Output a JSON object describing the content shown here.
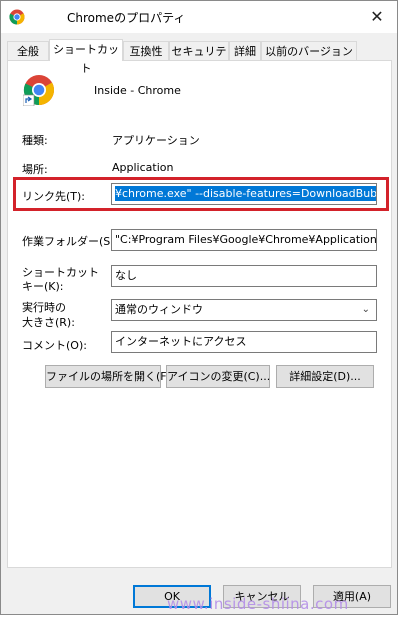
{
  "window": {
    "title": "Chromeのプロパティ",
    "close_glyph": "✕"
  },
  "tabs": [
    {
      "label": "全般",
      "active": false
    },
    {
      "label": "ショートカット",
      "active": true
    },
    {
      "label": "互換性",
      "active": false
    },
    {
      "label": "セキュリティ",
      "active": false
    },
    {
      "label": "詳細",
      "active": false
    },
    {
      "label": "以前のバージョン",
      "active": false
    }
  ],
  "shortcut": {
    "name": "Inside - Chrome",
    "type_label": "種類:",
    "type_value": "アプリケーション",
    "location_label": "場所:",
    "location_value": "Application",
    "target_label": "リンク先(T):",
    "target_value": "¥chrome.exe\" --disable-features=DownloadBubble",
    "startin_label": "作業フォルダー(S):",
    "startin_value": "\"C:¥Program Files¥Google¥Chrome¥Application\"",
    "hotkey_label_1": "ショートカット",
    "hotkey_label_2": "キー(K):",
    "hotkey_value": "なし",
    "run_label_1": "実行時の",
    "run_label_2": "大きさ(R):",
    "run_value": "通常のウィンドウ",
    "comment_label": "コメント(O):",
    "comment_value": "インターネットにアクセス"
  },
  "actions": {
    "open_location": "ファイルの場所を開く(F)",
    "change_icon": "アイコンの変更(C)...",
    "advanced": "詳細設定(D)..."
  },
  "footer": {
    "ok": "OK",
    "cancel": "キャンセル",
    "apply": "適用(A)"
  },
  "watermark": "www.inside-shiina.com",
  "colors": {
    "highlight": "#d3222a",
    "selection": "#0078d7"
  },
  "icons": {
    "app": "chrome-icon",
    "shortcut_overlay": "shortcut-arrow-icon"
  }
}
